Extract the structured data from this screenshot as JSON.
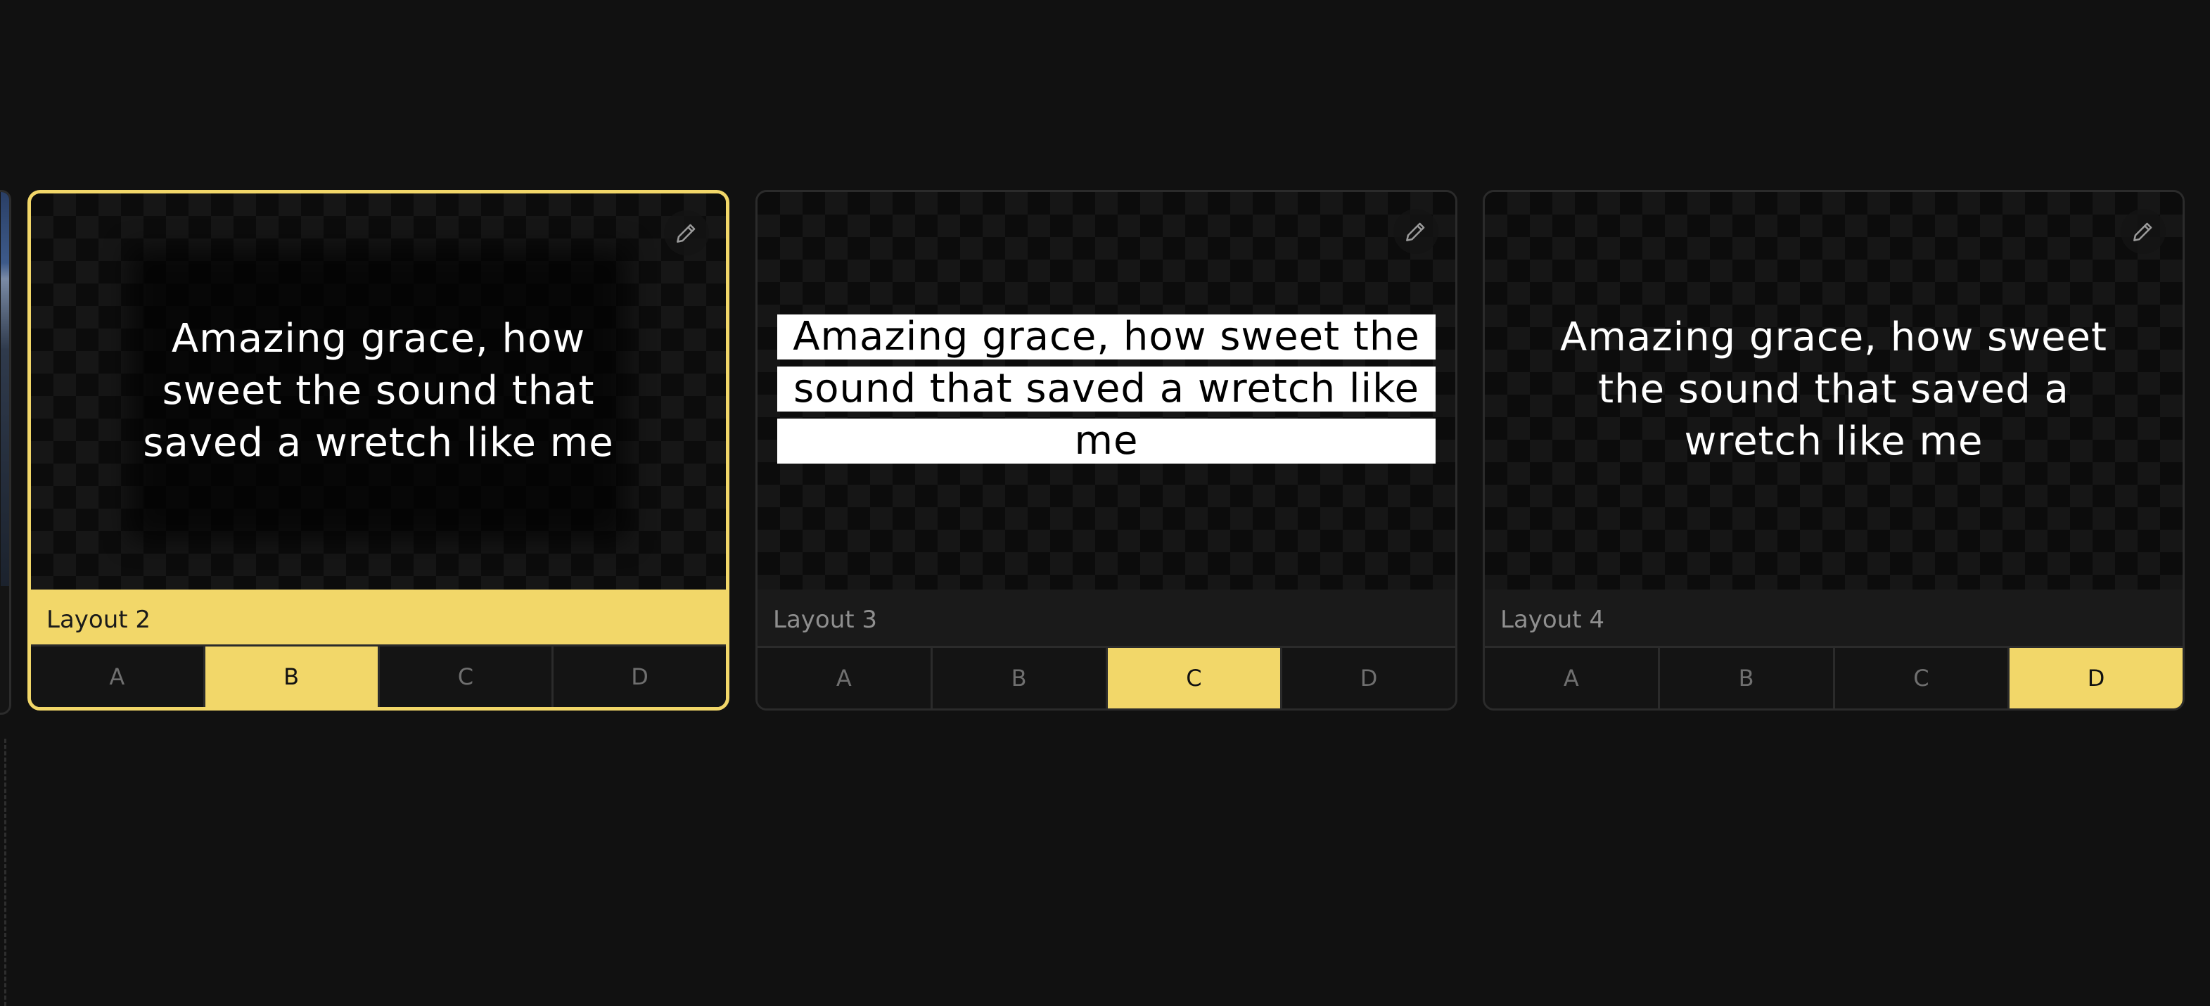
{
  "lyrics": {
    "full": "Amazing grace, how sweet the sound that saved a wretch like me",
    "layout2_lines": [
      "Amazing grace, how",
      "sweet the sound that",
      "saved a wretch like me"
    ],
    "layout3_lines": [
      "Amazing grace, how sweet the",
      "sound that saved a wretch like",
      "me"
    ],
    "layout4_lines": [
      "Amazing grace, how sweet",
      "the sound that saved a",
      "wretch like me"
    ]
  },
  "cards": [
    {
      "label": "Layout 2",
      "selected": true,
      "variants": [
        "A",
        "B",
        "C",
        "D"
      ],
      "active_variant": "B"
    },
    {
      "label": "Layout 3",
      "selected": false,
      "variants": [
        "A",
        "B",
        "C",
        "D"
      ],
      "active_variant": "C"
    },
    {
      "label": "Layout 4",
      "selected": false,
      "variants": [
        "A",
        "B",
        "C",
        "D"
      ],
      "active_variant": "D"
    }
  ],
  "icons": {
    "edit": "pencil-icon"
  },
  "colors": {
    "accent": "#f2d769",
    "background": "#111111",
    "card_border": "#2b2b2b"
  }
}
